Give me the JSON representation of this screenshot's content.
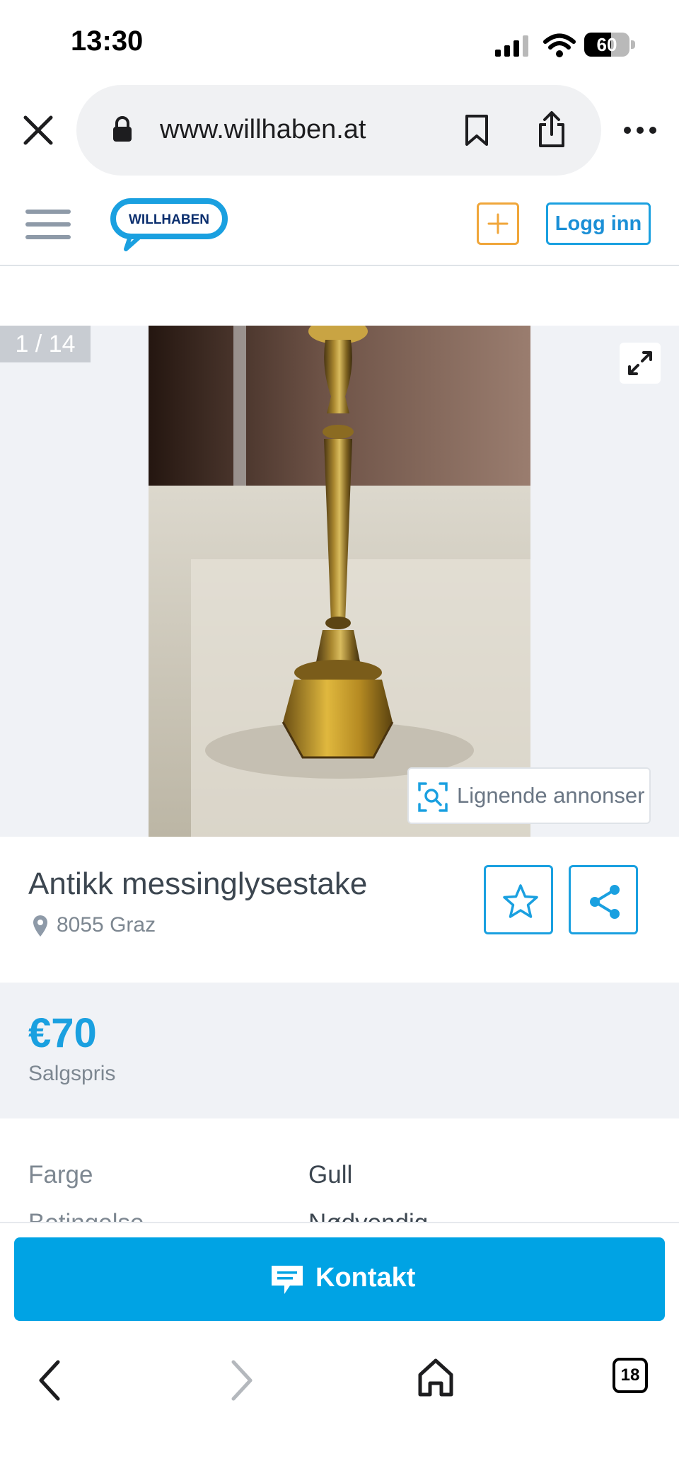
{
  "status_bar": {
    "time": "13:30",
    "battery_percent": "60",
    "battery_level": 0.6
  },
  "browser": {
    "url": "www.willhaben.at",
    "icons": [
      "close-icon",
      "lock-icon",
      "bookmark-icon",
      "share-icon",
      "more-icon"
    ]
  },
  "header": {
    "logo_text": "WILLHABEN",
    "login_label": "Logg inn",
    "icons": [
      "hamburger-menu-icon",
      "plus-icon"
    ]
  },
  "gallery": {
    "counter": "1 / 14",
    "similar_ads_label": "Lignende annonser",
    "icons": [
      "expand-icon",
      "visual-search-icon"
    ]
  },
  "ad": {
    "title": "Antikk messinglysestake",
    "location": "8055 Graz",
    "price": "€70",
    "price_label": "Salgspris",
    "attributes": [
      {
        "key": "Farge",
        "value": "Gull"
      },
      {
        "key": "Betingelse",
        "value": "Nødvendig"
      }
    ]
  },
  "contact": {
    "label": "Kontakt"
  },
  "bottom_toolbar": {
    "tab_count": "18",
    "icons": [
      "back-icon",
      "forward-icon",
      "home-icon",
      "tabs-icon"
    ]
  },
  "colors": {
    "brand_blue": "#00a3e4",
    "accent_orange": "#f0a63a",
    "gallery_bg": "#f0f2f6"
  }
}
